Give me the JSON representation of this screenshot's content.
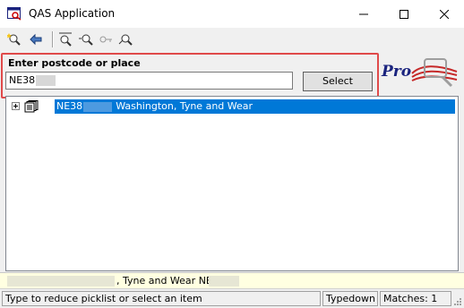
{
  "window": {
    "title": "QAS Application",
    "icon": "qas-app-icon",
    "controls": [
      "minimize-icon",
      "maximize-icon",
      "close-icon"
    ]
  },
  "toolbar": {
    "buttons": [
      {
        "name": "new-search-icon"
      },
      {
        "name": "back-arrow-icon"
      },
      {
        "name": "refine-search-icon"
      },
      {
        "name": "zoom-search-icon"
      },
      {
        "name": "key-search-icon"
      },
      {
        "name": "clear-search-icon"
      }
    ]
  },
  "search": {
    "prompt": "Enter postcode or place",
    "value": "NE38",
    "select_label": "Select"
  },
  "logo": {
    "text": "Pro"
  },
  "picklist": {
    "items": [
      {
        "code": "NE38",
        "place": "Washington, Tyne and Wear",
        "selected": true
      }
    ]
  },
  "full_address": {
    "text": ", Tyne and Wear NE38"
  },
  "status": {
    "message": "Type to reduce picklist or select an item",
    "mode": "Typedown",
    "matches": "Matches: 1"
  },
  "colors": {
    "selection": "#0078d7",
    "highlight_box": "#e04a4a",
    "logo_blue": "#1a237e",
    "tooltip_bg": "#ffffe1"
  }
}
